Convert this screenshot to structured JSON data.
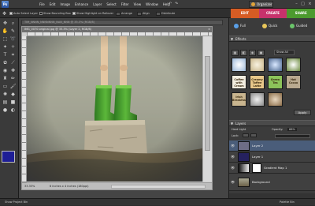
{
  "app": {
    "logo_text": "Ps"
  },
  "menu": [
    "File",
    "Edit",
    "Image",
    "Enhance",
    "Layer",
    "Select",
    "Filter",
    "View",
    "Window",
    "Help"
  ],
  "organizer": "Organizer",
  "options": {
    "auto_select": "Auto Select Layer",
    "bounding": "Show Bounding Box",
    "highlight": "Show Highlight on Rollover",
    "arrange": "Arrange",
    "align": "Align",
    "distribute": "Distribute"
  },
  "mode_tabs": [
    "EDIT",
    "CREATE",
    "SHARE"
  ],
  "document": {
    "tab_title": "TIM_NNNN_NNNNNNN_NAN_NNN @ 33.3% (RGB/8)",
    "title": "IMG_0070 original.jpg @ 33.3% (Layer 2, RGB/8)",
    "close": "×",
    "zoom": "33.33%",
    "info": "6 inches x 4 inches (180ppi)"
  },
  "panels": {
    "tabs": [
      "Full",
      "Quick",
      "Guided"
    ],
    "effects_title": "Effects",
    "show_all": "Show All",
    "filters": [
      {
        "label": "Coffee with Cream",
        "bg": "#f2ede0"
      },
      {
        "label": "Creamy Toffee Latte",
        "bg": "#e8c88a"
      },
      {
        "label": "Green Tea",
        "bg": "#8cc35a"
      },
      {
        "label": "Hot Cocoa",
        "bg": "#b9a98f"
      },
      {
        "label": "Irish Breakfast",
        "bg": "#c9b58f"
      }
    ],
    "apply": "Apply",
    "layers_title": "Layers",
    "blend_mode": "Hard Light",
    "opacity_label": "Opacity:",
    "opacity_value": "66%",
    "lock_label": "Lock:",
    "layers": [
      {
        "name": "Layer 2"
      },
      {
        "name": "Layer 1"
      },
      {
        "name": "Gradient Map 1"
      },
      {
        "name": "Background"
      }
    ]
  },
  "status": {
    "project_bin": "Show Project Bin",
    "palette_bin": "Palette Bin"
  },
  "colors": {
    "edit": "#d65c24",
    "create": "#c7326c",
    "share": "#4c9a2e",
    "foreground": "#1e1e96"
  }
}
